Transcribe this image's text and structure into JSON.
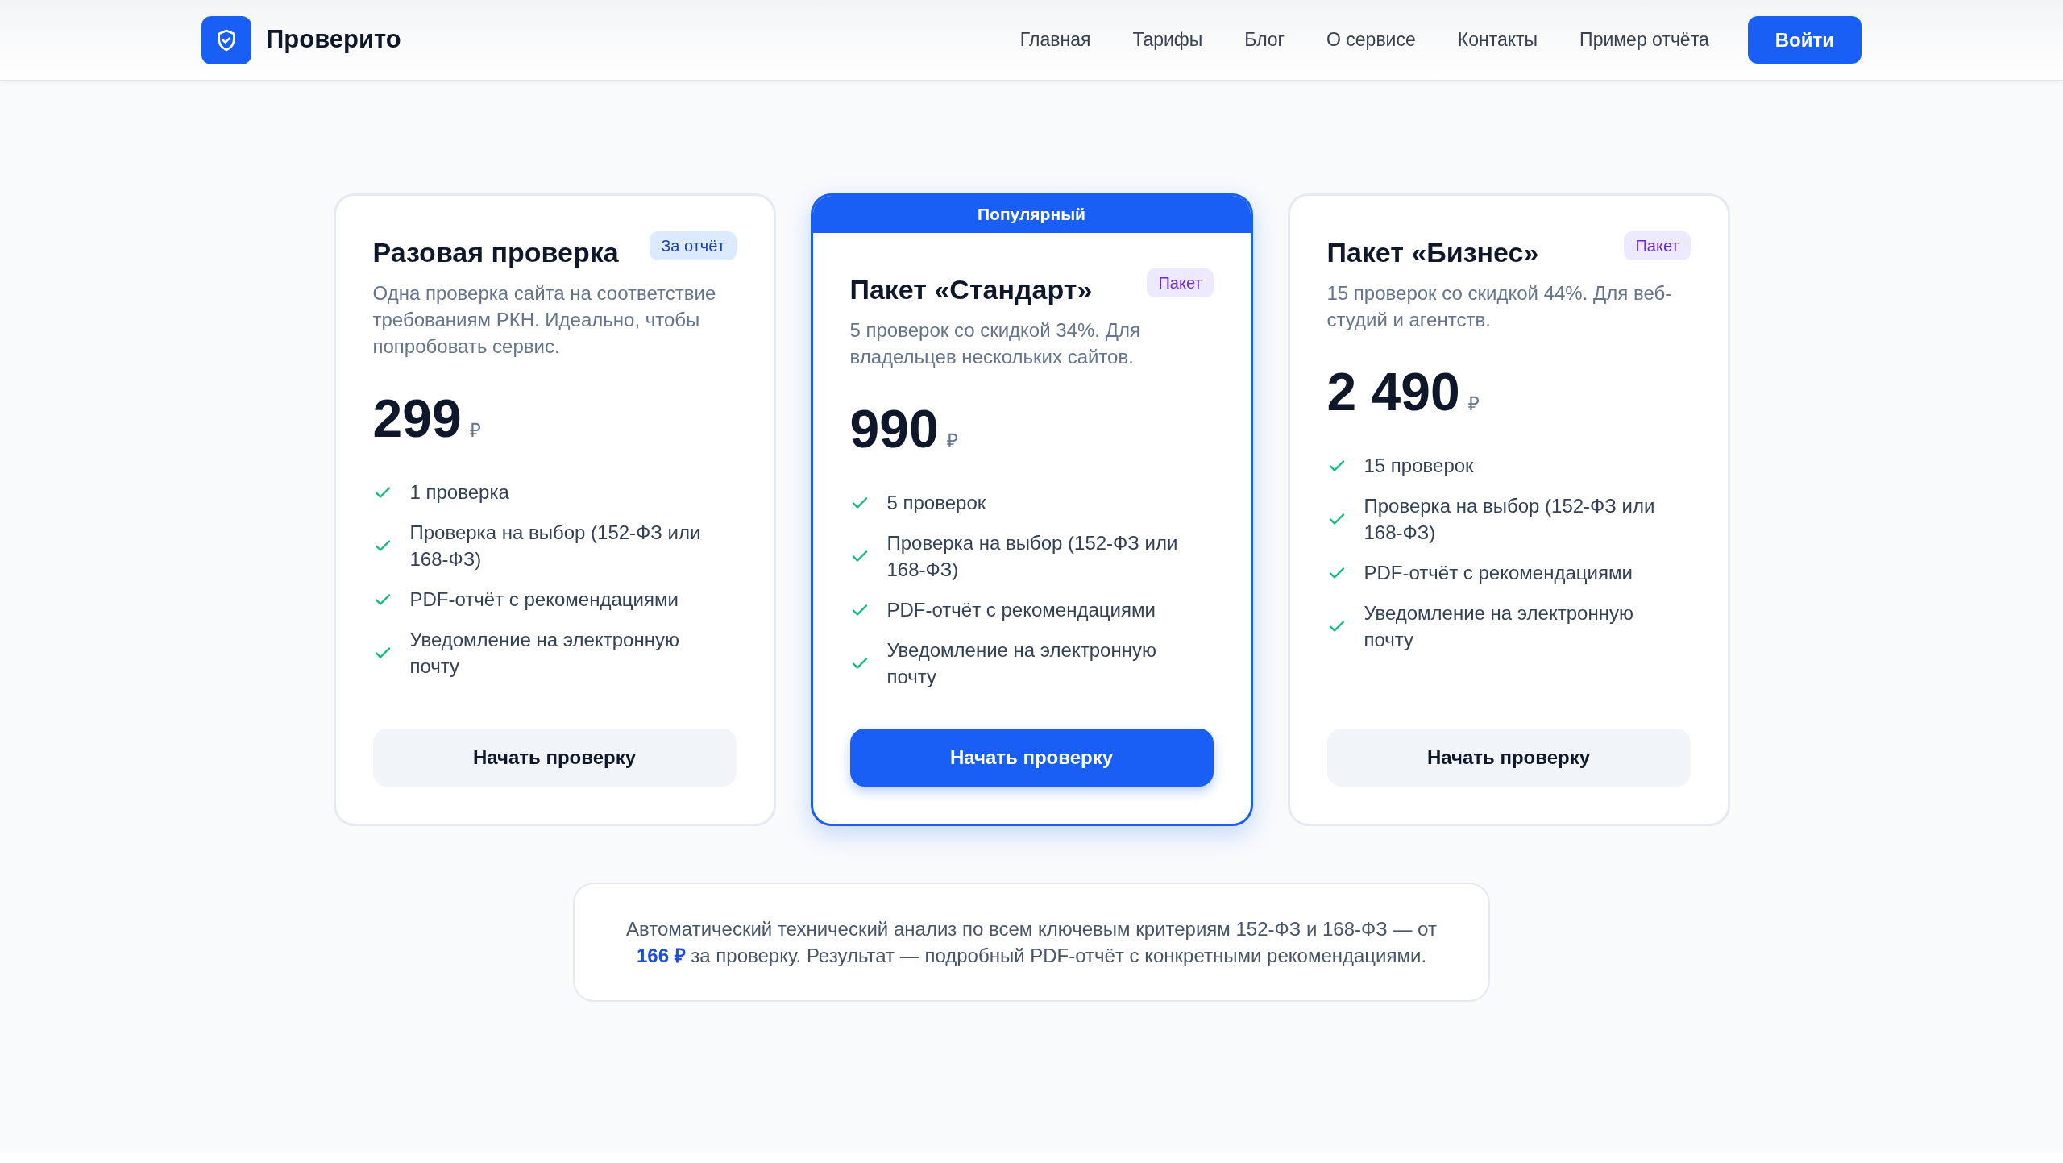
{
  "header": {
    "brand": "Проверито",
    "nav": [
      "Главная",
      "Тарифы",
      "Блог",
      "О сервисе",
      "Контакты",
      "Пример отчёта"
    ],
    "login": "Войти"
  },
  "plans": [
    {
      "featured": false,
      "title": "Разовая проверка",
      "badge": {
        "label": "За отчёт",
        "kind": "report"
      },
      "description": "Одна проверка сайта на соответствие требованиям РКН. Идеально, чтобы попробовать сервис.",
      "price": "299",
      "currency": "₽",
      "features": [
        "1 проверка",
        "Проверка на выбор (152-ФЗ или 168-ФЗ)",
        "PDF-отчёт с рекомендациями",
        "Уведомление на электронную почту"
      ],
      "button": "Начать проверку"
    },
    {
      "featured": true,
      "ribbon": "Популярный",
      "title": "Пакет «Стандарт»",
      "badge": {
        "label": "Пакет",
        "kind": "package"
      },
      "description": "5 проверок со скидкой 34%. Для владельцев нескольких сайтов.",
      "price": "990",
      "currency": "₽",
      "features": [
        "5 проверок",
        "Проверка на выбор (152-ФЗ или 168-ФЗ)",
        "PDF-отчёт с рекомендациями",
        "Уведомление на электронную почту"
      ],
      "button": "Начать проверку"
    },
    {
      "featured": false,
      "title": "Пакет «Бизнес»",
      "badge": {
        "label": "Пакет",
        "kind": "package"
      },
      "description": "15 проверок со скидкой 44%. Для веб-студий и агентств.",
      "price": "2 490",
      "currency": "₽",
      "features": [
        "15 проверок",
        "Проверка на выбор (152-ФЗ или 168-ФЗ)",
        "PDF-отчёт с рекомендациями",
        "Уведомление на электронную почту"
      ],
      "button": "Начать проверку"
    }
  ],
  "note": "Автоматический технический анализ по всем ключевым критериям 152-ФЗ и 168-ФЗ — от **166 ₽** за проверку. Результат — подробный PDF-отчёт с конкретными рекомендациями."
}
